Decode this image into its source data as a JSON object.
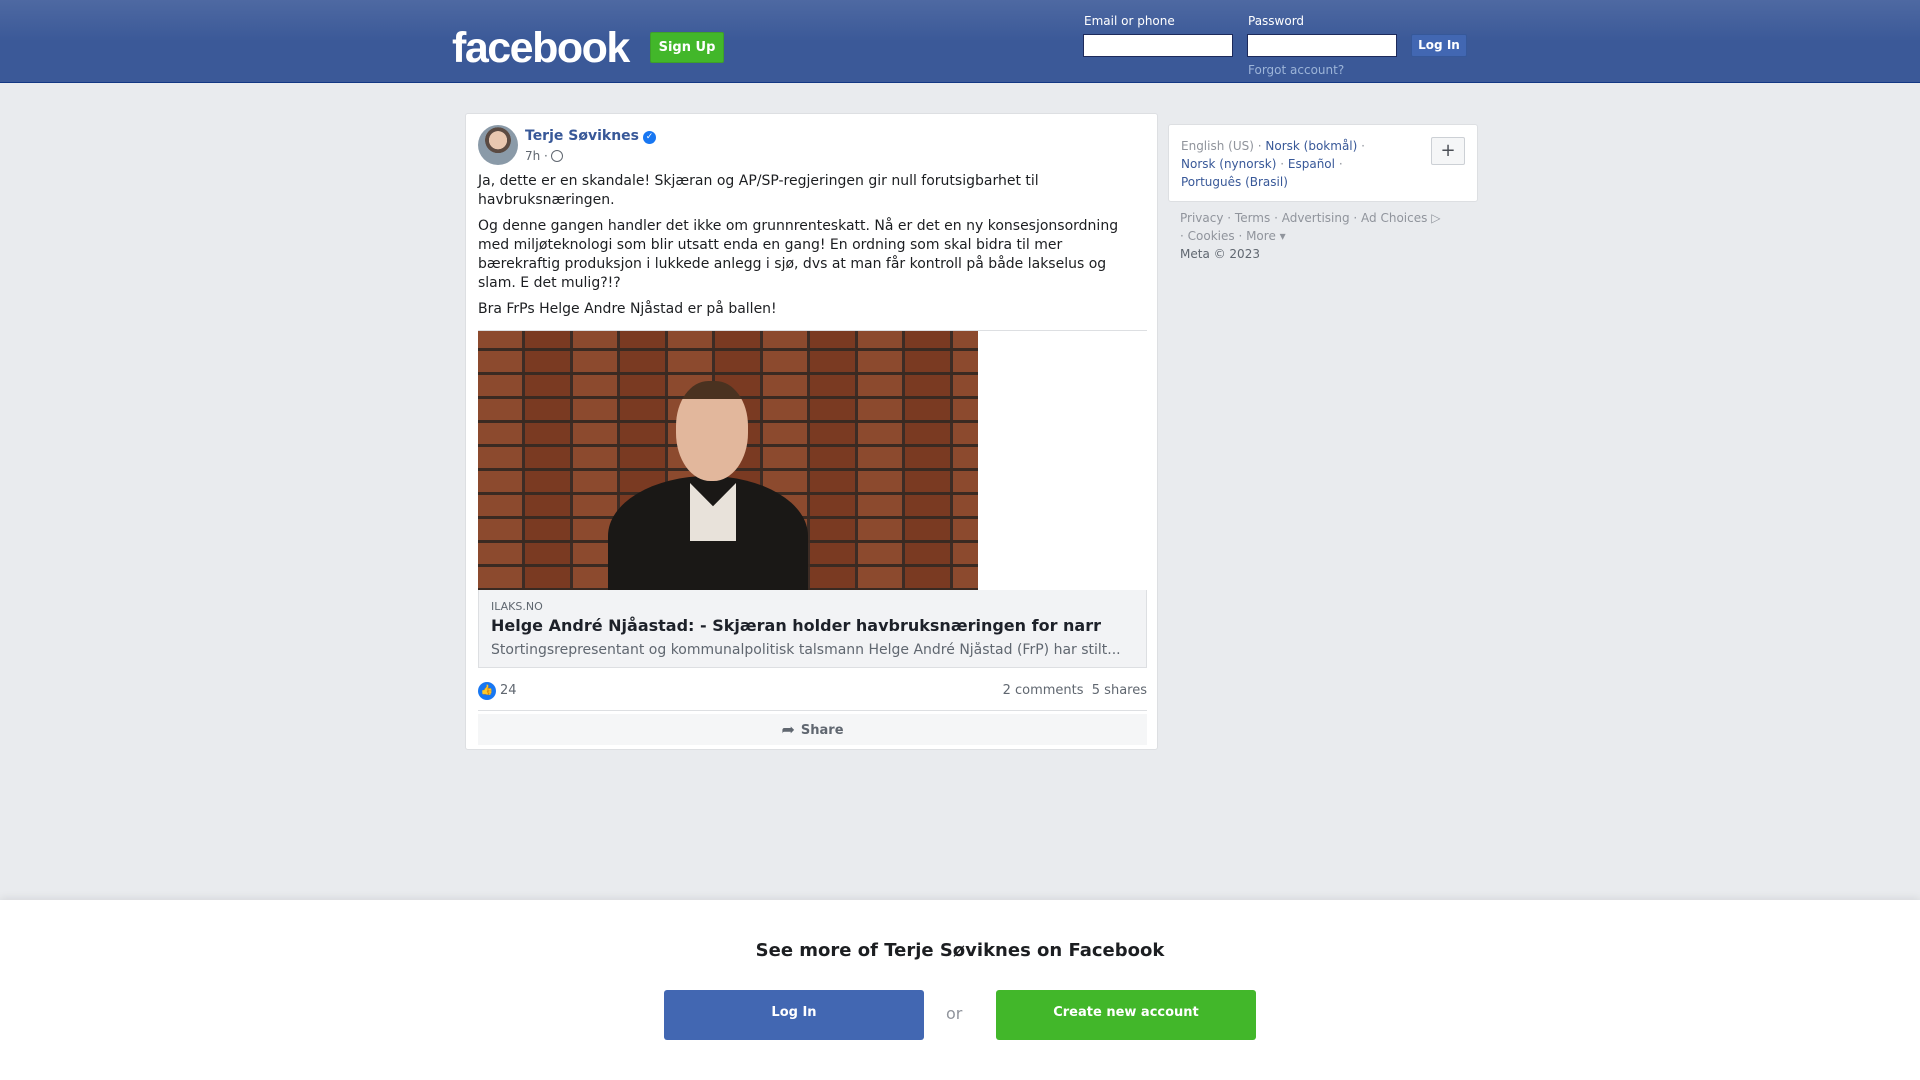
{
  "header": {
    "logo": "facebook",
    "signup_label": "Sign Up",
    "email_label": "Email or phone",
    "password_label": "Password",
    "login_label": "Log In",
    "forgot_label": "Forgot account?"
  },
  "post": {
    "author": "Terje Søviknes",
    "time": "7h ·",
    "paragraphs": [
      "Ja, dette er en skandale! Skjæran og AP/SP-regjeringen gir null forutsigbarhet til havbruksnæringen.",
      "Og denne gangen handler det ikke om grunnrenteskatt. Nå er det en ny konsesjonsordning med miljøteknologi som blir utsatt enda en gang! En ordning som skal bidra til mer bærekraftig produksjon i lukkede anlegg i sjø, dvs at man får kontroll på både lakselus og slam. E det mulig?!?",
      "Bra FrPs Helge Andre Njåstad er på ballen!"
    ],
    "link": {
      "domain": "ILAKS.NO",
      "title": "Helge André Njåastad: - Skjæran holder havbruksnæringen for narr",
      "description": "Stortingsrepresentant og kommunalpolitisk talsmann Helge André Njåstad (FrP) har stilt..."
    },
    "likes": "24",
    "comments": "2 comments",
    "shares": "5 shares",
    "share_label": "Share"
  },
  "sidebar": {
    "current_language": "English (US)",
    "languages": [
      "Norsk (bokmål)",
      "Norsk (nynorsk)",
      "Español",
      "Português (Brasil)"
    ],
    "plus_label": "+",
    "footer_links": [
      "Privacy",
      "Terms",
      "Advertising",
      "Ad Choices",
      "Cookies",
      "More"
    ],
    "copyright": "Meta © 2023"
  },
  "banner": {
    "headline": "See more of Terje Søviknes on Facebook",
    "login_label": "Log In",
    "or_label": "or",
    "create_label": "Create new account"
  },
  "colors": {
    "brand_blue": "#3b5998",
    "button_blue": "#4267b2",
    "green": "#42b72a"
  }
}
